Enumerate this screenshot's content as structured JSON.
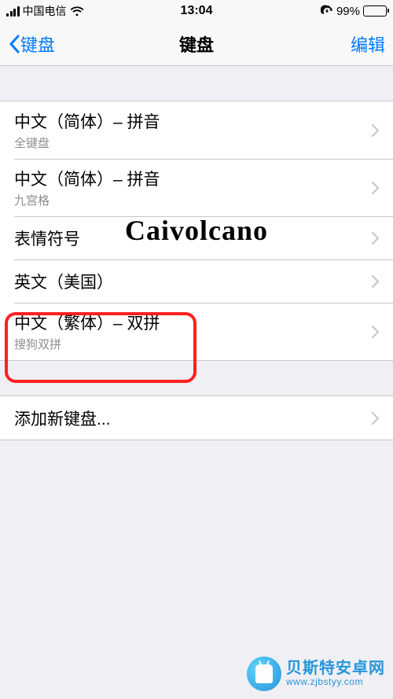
{
  "status": {
    "carrier": "中国电信",
    "time": "13:04",
    "battery_pct": "99%"
  },
  "nav": {
    "back_label": "键盘",
    "title": "键盘",
    "edit_label": "编辑"
  },
  "keyboards": [
    {
      "title": "中文（简体）– 拼音",
      "sub": "全键盘"
    },
    {
      "title": "中文（简体）– 拼音",
      "sub": "九宫格"
    },
    {
      "title": "表情符号",
      "sub": ""
    },
    {
      "title": "英文（美国）",
      "sub": ""
    },
    {
      "title": "中文（繁体）– 双拼",
      "sub": "搜狗双拼"
    }
  ],
  "add": {
    "label": "添加新键盘..."
  },
  "watermark": {
    "script": "Caivolcano",
    "site_cn": "贝斯特安卓网",
    "site_url": "www.zjbstyy.com"
  },
  "colors": {
    "tint": "#007aff",
    "highlight": "#ff2020",
    "battery": "#4cd964"
  }
}
